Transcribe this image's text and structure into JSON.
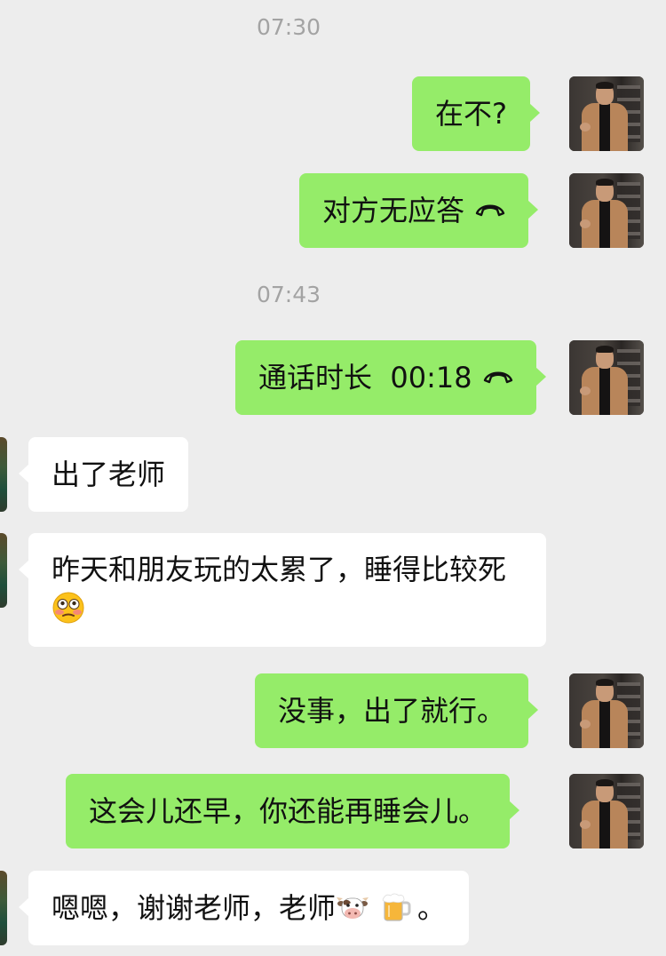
{
  "timestamps": [
    "07:30",
    "07:43"
  ],
  "messages": [
    {
      "from": "me",
      "text": "在不?"
    },
    {
      "from": "me",
      "text": "对方无应答",
      "icon": "hangup-icon"
    },
    {
      "from": "me",
      "text": "通话时长  00:18",
      "icon": "hangup-icon"
    },
    {
      "from": "them",
      "text": "出了老师"
    },
    {
      "from": "them",
      "text": "昨天和朋友玩的太累了，睡得比较死",
      "emoji": "flushed-face-emoji"
    },
    {
      "from": "me",
      "text": "没事，出了就行。"
    },
    {
      "from": "me",
      "text": "这会儿还早，你还能再睡会儿。"
    },
    {
      "from": "them",
      "text": "嗯嗯，谢谢老师，老师",
      "emojis": [
        "cow-face-emoji",
        "beer-mug-emoji"
      ],
      "suffix": "。"
    }
  ],
  "colors": {
    "background": "#ededed",
    "sent_bubble": "#95ec69",
    "received_bubble": "#ffffff",
    "timestamp": "#a3a3a3"
  }
}
